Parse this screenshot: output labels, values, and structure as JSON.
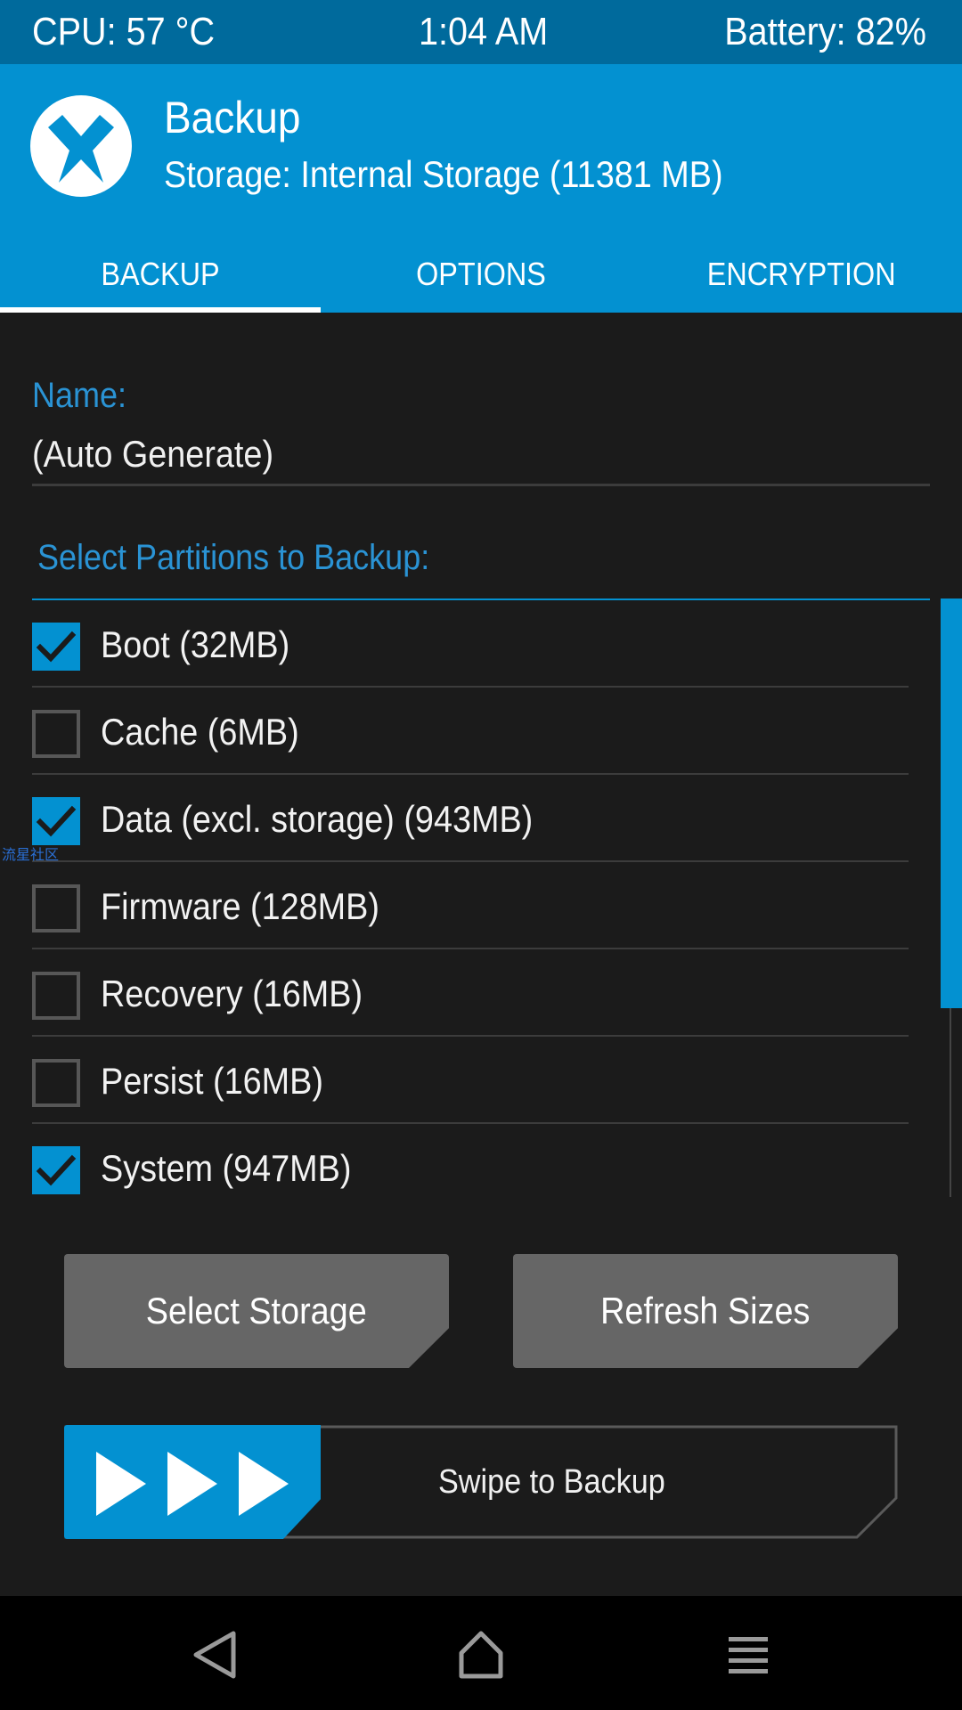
{
  "status_bar": {
    "cpu": "CPU: 57 °C",
    "time": "1:04 AM",
    "battery": "Battery: 82%"
  },
  "header": {
    "title": "Backup",
    "storage": "Storage: Internal Storage (11381 MB)",
    "logo_icon": "twrp-logo-icon"
  },
  "tabs": [
    {
      "label": "BACKUP",
      "active": true
    },
    {
      "label": "OPTIONS",
      "active": false
    },
    {
      "label": "ENCRYPTION",
      "active": false
    }
  ],
  "name_field": {
    "label": "Name:",
    "value": "(Auto Generate)"
  },
  "partitions": {
    "title": "Select Partitions to Backup:",
    "items": [
      {
        "label": "Boot (32MB)",
        "checked": true
      },
      {
        "label": "Cache (6MB)",
        "checked": false
      },
      {
        "label": "Data (excl. storage) (943MB)",
        "checked": true
      },
      {
        "label": "Firmware (128MB)",
        "checked": false
      },
      {
        "label": "Recovery (16MB)",
        "checked": false
      },
      {
        "label": "Persist (16MB)",
        "checked": false
      },
      {
        "label": "System (947MB)",
        "checked": true
      }
    ]
  },
  "watermark": "流星社区",
  "buttons": {
    "select_storage": "Select Storage",
    "refresh_sizes": "Refresh Sizes"
  },
  "swipe": {
    "label": "Swipe to Backup"
  },
  "colors": {
    "accent": "#0391d1",
    "status_bar": "#006a9c",
    "background": "#1b1b1b",
    "button": "#666666",
    "label_blue": "#2a93d4"
  }
}
